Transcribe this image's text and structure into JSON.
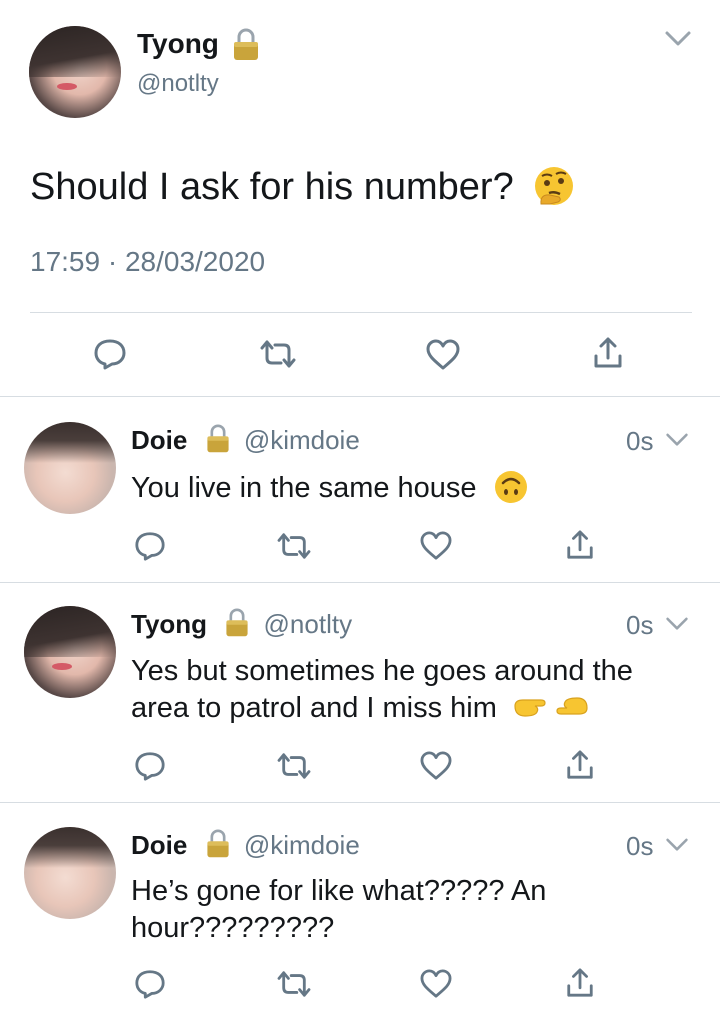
{
  "main_tweet": {
    "name": "Tyong",
    "handle": "@notlty",
    "text": "Should I ask for his number?",
    "emoji": "thinking-face",
    "timestamp": "17:59 · 28/03/2020"
  },
  "replies": [
    {
      "name": "Doie",
      "handle": "@kimdoie",
      "time": "0s",
      "lines": [
        "You live in the same house"
      ],
      "emoji": "upside-down-face"
    },
    {
      "name": "Tyong",
      "handle": "@notlty",
      "time": "0s",
      "lines": [
        "Yes but sometimes he goes around the",
        "area to patrol and I miss him"
      ],
      "emoji": "index-fingers-pointing"
    },
    {
      "name": "Doie",
      "handle": "@kimdoie",
      "time": "0s",
      "lines": [
        "He’s gone for like what????? An",
        "hour?????????"
      ],
      "emoji": ""
    }
  ],
  "icons": {
    "reply": "reply-icon",
    "retweet": "retweet-icon",
    "like": "heart-icon",
    "share": "share-icon",
    "lock": "lock-icon",
    "chevron": "chevron-down-icon"
  },
  "colors": {
    "icon_gray": "#657786",
    "divider": "#d7dde2",
    "lock_gold": "#c9a43b"
  }
}
